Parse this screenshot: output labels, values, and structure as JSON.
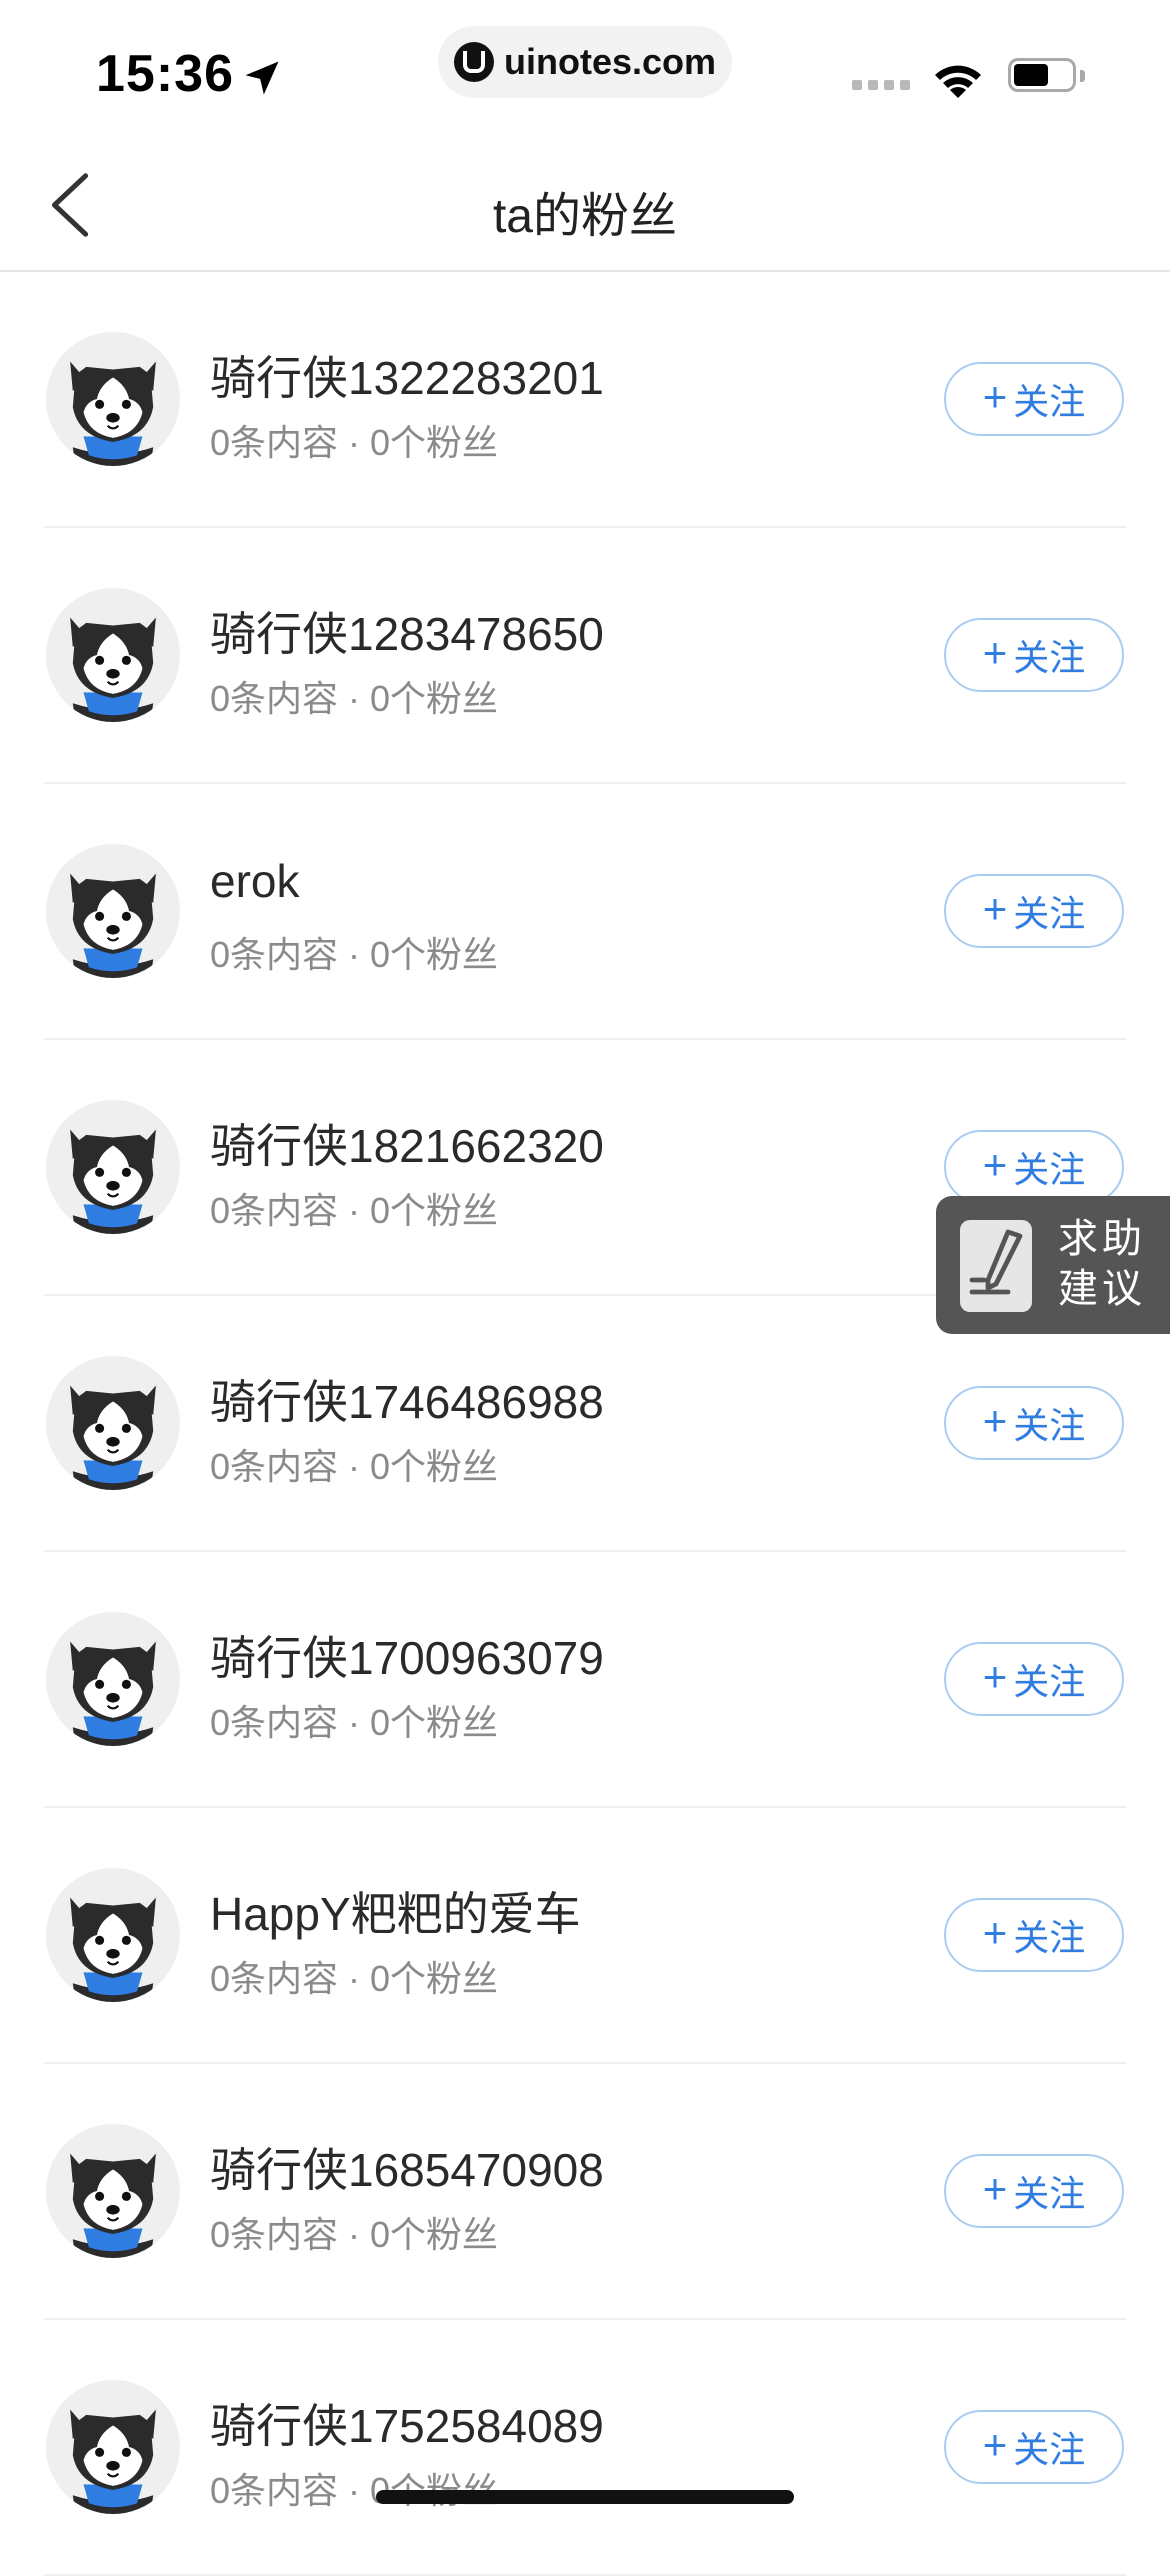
{
  "status_bar": {
    "time": "15:36",
    "url": "uinotes.com",
    "battery_level": 0.6
  },
  "nav": {
    "title": "ta的粉丝"
  },
  "followers": [
    {
      "name": "骑行侠1322283201",
      "meta": "0条内容 · 0个粉丝",
      "button": "关注"
    },
    {
      "name": "骑行侠1283478650",
      "meta": "0条内容 · 0个粉丝",
      "button": "关注"
    },
    {
      "name": "erok",
      "meta": "0条内容 · 0个粉丝",
      "button": "关注"
    },
    {
      "name": "骑行侠1821662320",
      "meta": "0条内容 · 0个粉丝",
      "button": "关注"
    },
    {
      "name": "骑行侠1746486988",
      "meta": "0条内容 · 0个粉丝",
      "button": "关注"
    },
    {
      "name": "骑行侠1700963079",
      "meta": "0条内容 · 0个粉丝",
      "button": "关注"
    },
    {
      "name": "HappY粑粑的爱车",
      "meta": "0条内容 · 0个粉丝",
      "button": "关注"
    },
    {
      "name": "骑行侠1685470908",
      "meta": "0条内容 · 0个粉丝",
      "button": "关注"
    },
    {
      "name": "骑行侠1752584089",
      "meta": "0条内容 · 0个粉丝",
      "button": "关注"
    }
  ],
  "follow_plus": "+",
  "help": {
    "label_line1": "求助",
    "label_line2": "建议"
  },
  "colors": {
    "accent": "#2f7de1",
    "button_border": "#a9ccf2",
    "help_bg": "#555555"
  }
}
